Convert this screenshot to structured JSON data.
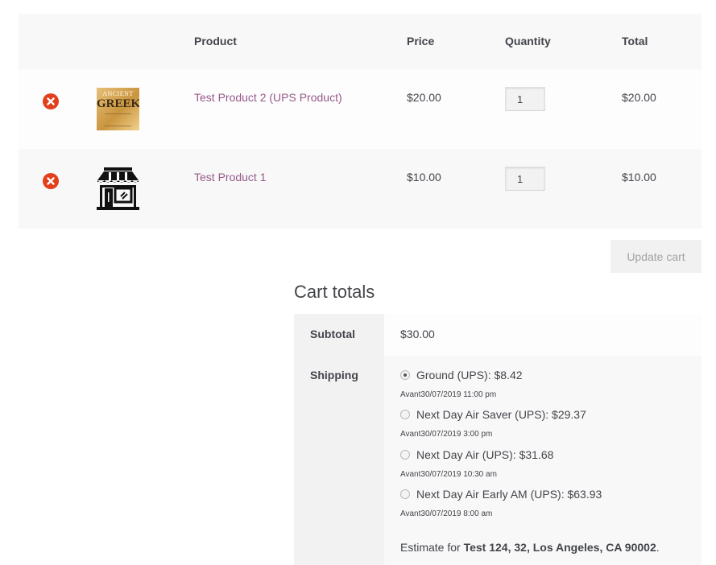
{
  "table": {
    "headers": {
      "product": "Product",
      "price": "Price",
      "quantity": "Quantity",
      "total": "Total"
    },
    "items": [
      {
        "name": "Test Product 2 (UPS Product)",
        "price": "$20.00",
        "qty": "1",
        "total": "$20.00",
        "thumb": {
          "line1": "ANCIENT",
          "line2": "GREEK"
        }
      },
      {
        "name": "Test Product 1",
        "price": "$10.00",
        "qty": "1",
        "total": "$10.00"
      }
    ]
  },
  "update_cart_label": "Update cart",
  "totals": {
    "title": "Cart totals",
    "subtotal_label": "Subtotal",
    "subtotal_value": "$30.00",
    "shipping_label": "Shipping",
    "options": [
      {
        "label": "Ground (UPS): $8.42",
        "eta": "Avant30/07/2019 11:00 pm",
        "selected": true
      },
      {
        "label": "Next Day Air Saver (UPS): $29.37",
        "eta": "Avant30/07/2019 3:00 pm",
        "selected": false
      },
      {
        "label": "Next Day Air (UPS): $31.68",
        "eta": "Avant30/07/2019 10:30 am",
        "selected": false
      },
      {
        "label": "Next Day Air Early AM (UPS): $63.93",
        "eta": "Avant30/07/2019 8:00 am",
        "selected": false
      }
    ],
    "estimate_prefix": "Estimate for ",
    "estimate_address": "Test 124, 32, Los Angeles, CA 90002",
    "estimate_suffix": "."
  },
  "colors": {
    "link": "#96588a",
    "remove": "#e2401c"
  }
}
